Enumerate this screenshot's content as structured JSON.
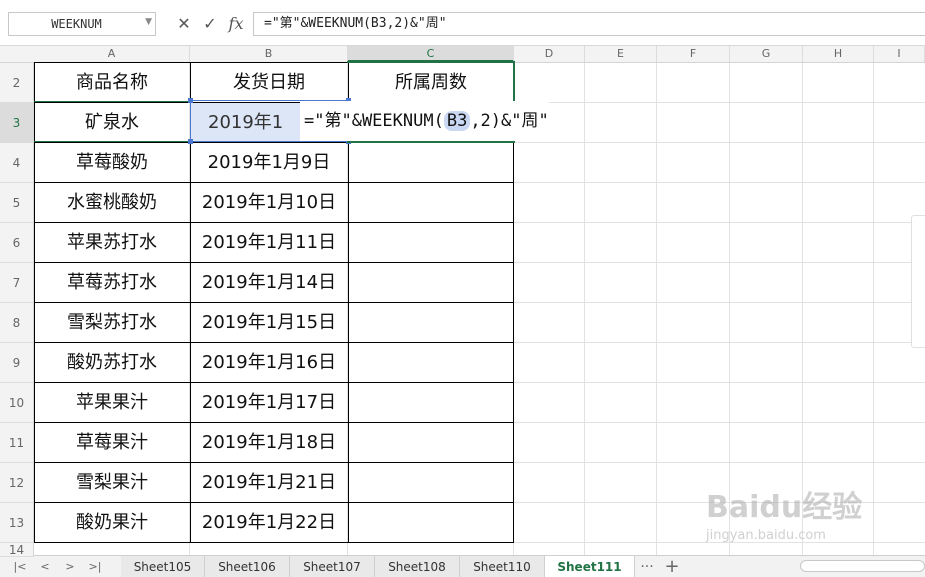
{
  "formula_bar": {
    "name_box": "WEEKNUM",
    "cancel_glyph": "✕",
    "confirm_glyph": "✓",
    "fx_label": "fx",
    "formula": "=\"第\"&WEEKNUM(B3,2)&\"周\""
  },
  "columns": [
    "A",
    "B",
    "C",
    "D",
    "E",
    "F",
    "G",
    "H",
    "I"
  ],
  "rows": [
    "2",
    "3",
    "4",
    "5",
    "6",
    "7",
    "8",
    "9",
    "10",
    "11",
    "12",
    "13",
    "14"
  ],
  "table": {
    "headers": [
      "商品名称",
      "发货日期",
      "所属周数"
    ],
    "rows": [
      {
        "name": "矿泉水",
        "date": "2019年1"
      },
      {
        "name": "草莓酸奶",
        "date": "2019年1月9日"
      },
      {
        "name": "水蜜桃酸奶",
        "date": "2019年1月10日"
      },
      {
        "name": "苹果苏打水",
        "date": "2019年1月11日"
      },
      {
        "name": "草莓苏打水",
        "date": "2019年1月14日"
      },
      {
        "name": "雪梨苏打水",
        "date": "2019年1月15日"
      },
      {
        "name": "酸奶苏打水",
        "date": "2019年1月16日"
      },
      {
        "name": "苹果果汁",
        "date": "2019年1月17日"
      },
      {
        "name": "草莓果汁",
        "date": "2019年1月18日"
      },
      {
        "name": "雪梨果汁",
        "date": "2019年1月21日"
      },
      {
        "name": "酸奶果汁",
        "date": "2019年1月22日"
      }
    ]
  },
  "edit_cell": {
    "prefix": "=\"第\"&WEEKNUM(",
    "ref": "B3",
    "suffix": ",2)&\"周\""
  },
  "tabs": {
    "sheets": [
      "Sheet105",
      "Sheet106",
      "Sheet107",
      "Sheet108",
      "Sheet110",
      "Sheet111"
    ],
    "active": "Sheet111",
    "more": "···",
    "add": "+"
  },
  "nav": {
    "first": "|<",
    "prev": "<",
    "next": ">",
    "last": ">|"
  },
  "watermark": {
    "logo": "Baidu经验",
    "sub": "jingyan.baidu.com"
  },
  "colors": {
    "accent": "#217346",
    "ref_highlight": "#c9d7f2",
    "selection": "#dce6f7"
  }
}
